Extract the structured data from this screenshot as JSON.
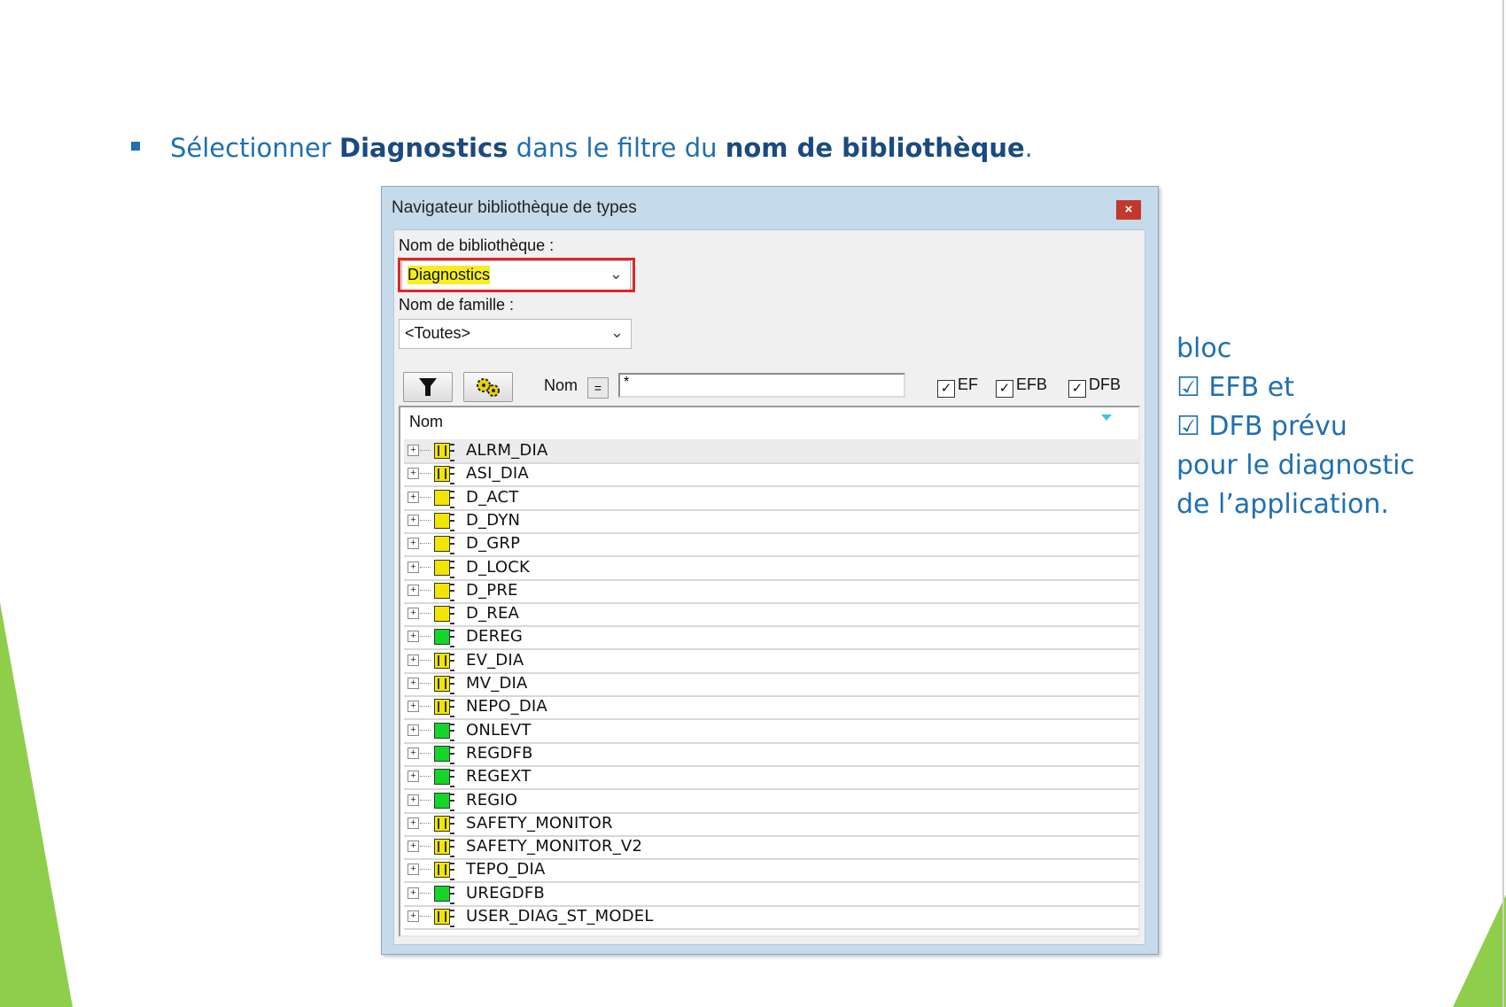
{
  "slide": {
    "instruction_prefix": "Sélectionner ",
    "instruction_bold1": "Diagnostics",
    "instruction_mid": " dans le filtre du ",
    "instruction_bold2": "nom de bibliothèque",
    "instruction_suffix": ".",
    "side_note": [
      "bloc",
      "☑ EFB et",
      "☑ DFB prévu",
      "pour le diagnostic",
      "de l’application."
    ],
    "accent_color": "#1f6fb2"
  },
  "dialog": {
    "title": "Navigateur bibliothèque de types",
    "close_label": "×",
    "library_label": "Nom de bibliothèque :",
    "library_value": "Diagnostics",
    "family_label": "Nom de famille :",
    "family_value": "<Toutes>",
    "name_filter_label": "Nom",
    "name_operator": "=",
    "name_filter_value": "*",
    "checkboxes": [
      {
        "label": "EF",
        "checked": true
      },
      {
        "label": "EFB",
        "checked": true
      },
      {
        "label": "DFB",
        "checked": true
      }
    ],
    "list_header": "Nom",
    "items": [
      {
        "name": "ALRM_DIA",
        "type": "ef"
      },
      {
        "name": "ASI_DIA",
        "type": "ef"
      },
      {
        "name": "D_ACT",
        "type": "dfb"
      },
      {
        "name": "D_DYN",
        "type": "dfb"
      },
      {
        "name": "D_GRP",
        "type": "dfb"
      },
      {
        "name": "D_LOCK",
        "type": "dfb"
      },
      {
        "name": "D_PRE",
        "type": "dfb"
      },
      {
        "name": "D_REA",
        "type": "dfb"
      },
      {
        "name": "DEREG",
        "type": "efb"
      },
      {
        "name": "EV_DIA",
        "type": "ef"
      },
      {
        "name": "MV_DIA",
        "type": "ef"
      },
      {
        "name": "NEPO_DIA",
        "type": "ef"
      },
      {
        "name": "ONLEVT",
        "type": "efb"
      },
      {
        "name": "REGDFB",
        "type": "efb"
      },
      {
        "name": "REGEXT",
        "type": "efb"
      },
      {
        "name": "REGIO",
        "type": "efb"
      },
      {
        "name": "SAFETY_MONITOR",
        "type": "ef"
      },
      {
        "name": "SAFETY_MONITOR_V2",
        "type": "ef"
      },
      {
        "name": "TEPO_DIA",
        "type": "ef"
      },
      {
        "name": "UREGDFB",
        "type": "efb"
      },
      {
        "name": "USER_DIAG_ST_MODEL",
        "type": "ef"
      }
    ]
  }
}
